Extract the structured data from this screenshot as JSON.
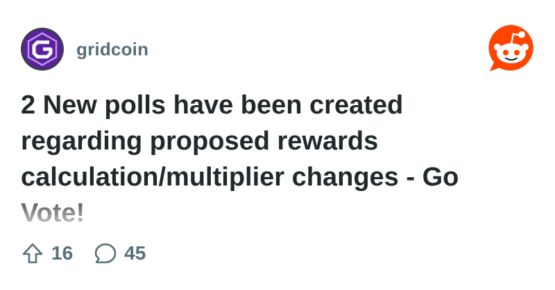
{
  "post": {
    "community": "gridcoin",
    "community_icon": "gridcoin-logo-icon",
    "site_icon": "reddit-snoo-logo-icon",
    "title": "2 New polls have been created regarding proposed rewards calculation/multiplier changes - Go Vote!",
    "upvotes": "16",
    "comments": "45"
  },
  "colors": {
    "meta_text": "#576f76",
    "title_text": "#22292b",
    "brand_orange": "#ff4500",
    "avatar_purple": "#5b1fa0"
  }
}
